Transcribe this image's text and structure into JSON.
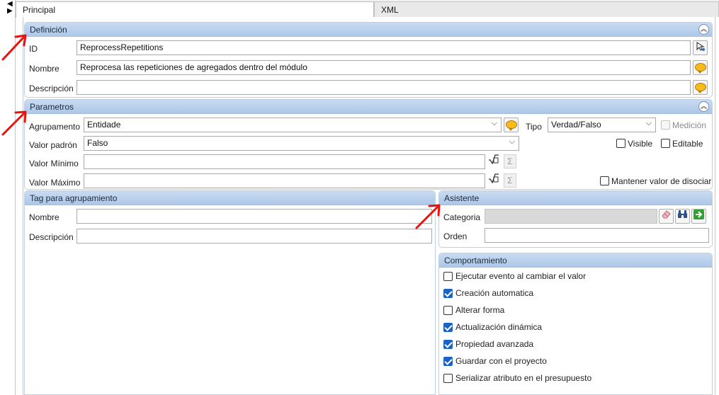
{
  "tabs": [
    {
      "label": "Principal",
      "active": true
    },
    {
      "label": "XML",
      "active": false
    }
  ],
  "definicion": {
    "title": "Definición",
    "id_label": "ID",
    "id_value": "ReprocessRepetitions",
    "nombre_label": "Nombre",
    "nombre_value": "Reprocesa las repeticiones de agregados dentro del módulo",
    "descripcion_label": "Descripción",
    "descripcion_value": ""
  },
  "parametros": {
    "title": "Parametros",
    "agrupamiento_label": "Agrupamento",
    "agrupamiento_value": "Entidade",
    "tipo_label": "Tipo",
    "tipo_value": "Verdad/Falso",
    "medicion_label": "Medición",
    "medicion_checked": false,
    "valor_padron_label": "Valor padrón",
    "valor_padron_value": "Falso",
    "visible_label": "Visible",
    "visible_checked": false,
    "editable_label": "Editable",
    "editable_checked": false,
    "valor_minimo_label": "Valor Mínimo",
    "valor_minimo_value": "",
    "valor_maximo_label": "Valor Máximo",
    "valor_maximo_value": "",
    "mantener_label": "Mantener valor de disociar",
    "mantener_checked": false
  },
  "tag": {
    "title": "Tag para agrupamiento",
    "nombre_label": "Nombre",
    "nombre_value": "",
    "descripcion_label": "Descripción",
    "descripcion_value": ""
  },
  "asistente": {
    "title": "Asistente",
    "categoria_label": "Categoria",
    "categoria_value": "",
    "orden_label": "Orden",
    "orden_value": ""
  },
  "comportamiento": {
    "title": "Comportamiento",
    "items": [
      {
        "label": "Ejecutar evento al cambiar el valor",
        "checked": false
      },
      {
        "label": "Creación automatica",
        "checked": true
      },
      {
        "label": "Alterar forma",
        "checked": false
      },
      {
        "label": "Actualización dinámica",
        "checked": true
      },
      {
        "label": "Propiedad avanzada",
        "checked": true
      },
      {
        "label": "Guardar con el proyecto",
        "checked": true
      },
      {
        "label": "Serializar atributo en el presupuesto",
        "checked": false
      }
    ]
  },
  "icons": {
    "collapse": "double-chevron-up-icon",
    "id_button": "cursor-pick-icon",
    "translate": "speech-bubble-icon",
    "formula": "square-root-icon",
    "sigma": "sigma-icon",
    "eraser": "eraser-icon",
    "search": "binoculars-icon",
    "go": "green-arrow-right-icon"
  },
  "colors": {
    "group_header": "#b9cfec",
    "annotation_arrow": "#e8130f",
    "check_accent": "#1a64c8"
  }
}
